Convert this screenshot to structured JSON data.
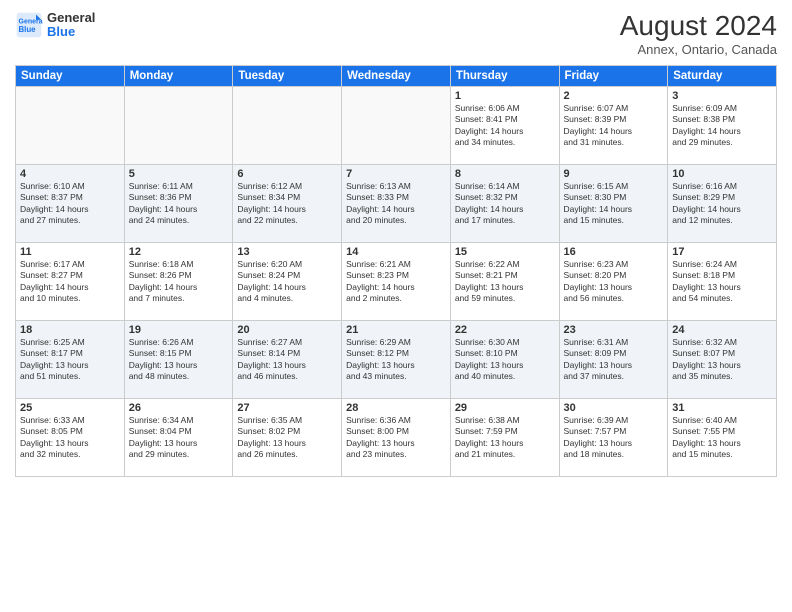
{
  "header": {
    "logo_line1": "General",
    "logo_line2": "Blue",
    "month_year": "August 2024",
    "location": "Annex, Ontario, Canada"
  },
  "weekdays": [
    "Sunday",
    "Monday",
    "Tuesday",
    "Wednesday",
    "Thursday",
    "Friday",
    "Saturday"
  ],
  "weeks": [
    [
      {
        "day": "",
        "info": ""
      },
      {
        "day": "",
        "info": ""
      },
      {
        "day": "",
        "info": ""
      },
      {
        "day": "",
        "info": ""
      },
      {
        "day": "1",
        "info": "Sunrise: 6:06 AM\nSunset: 8:41 PM\nDaylight: 14 hours\nand 34 minutes."
      },
      {
        "day": "2",
        "info": "Sunrise: 6:07 AM\nSunset: 8:39 PM\nDaylight: 14 hours\nand 31 minutes."
      },
      {
        "day": "3",
        "info": "Sunrise: 6:09 AM\nSunset: 8:38 PM\nDaylight: 14 hours\nand 29 minutes."
      }
    ],
    [
      {
        "day": "4",
        "info": "Sunrise: 6:10 AM\nSunset: 8:37 PM\nDaylight: 14 hours\nand 27 minutes."
      },
      {
        "day": "5",
        "info": "Sunrise: 6:11 AM\nSunset: 8:36 PM\nDaylight: 14 hours\nand 24 minutes."
      },
      {
        "day": "6",
        "info": "Sunrise: 6:12 AM\nSunset: 8:34 PM\nDaylight: 14 hours\nand 22 minutes."
      },
      {
        "day": "7",
        "info": "Sunrise: 6:13 AM\nSunset: 8:33 PM\nDaylight: 14 hours\nand 20 minutes."
      },
      {
        "day": "8",
        "info": "Sunrise: 6:14 AM\nSunset: 8:32 PM\nDaylight: 14 hours\nand 17 minutes."
      },
      {
        "day": "9",
        "info": "Sunrise: 6:15 AM\nSunset: 8:30 PM\nDaylight: 14 hours\nand 15 minutes."
      },
      {
        "day": "10",
        "info": "Sunrise: 6:16 AM\nSunset: 8:29 PM\nDaylight: 14 hours\nand 12 minutes."
      }
    ],
    [
      {
        "day": "11",
        "info": "Sunrise: 6:17 AM\nSunset: 8:27 PM\nDaylight: 14 hours\nand 10 minutes."
      },
      {
        "day": "12",
        "info": "Sunrise: 6:18 AM\nSunset: 8:26 PM\nDaylight: 14 hours\nand 7 minutes."
      },
      {
        "day": "13",
        "info": "Sunrise: 6:20 AM\nSunset: 8:24 PM\nDaylight: 14 hours\nand 4 minutes."
      },
      {
        "day": "14",
        "info": "Sunrise: 6:21 AM\nSunset: 8:23 PM\nDaylight: 14 hours\nand 2 minutes."
      },
      {
        "day": "15",
        "info": "Sunrise: 6:22 AM\nSunset: 8:21 PM\nDaylight: 13 hours\nand 59 minutes."
      },
      {
        "day": "16",
        "info": "Sunrise: 6:23 AM\nSunset: 8:20 PM\nDaylight: 13 hours\nand 56 minutes."
      },
      {
        "day": "17",
        "info": "Sunrise: 6:24 AM\nSunset: 8:18 PM\nDaylight: 13 hours\nand 54 minutes."
      }
    ],
    [
      {
        "day": "18",
        "info": "Sunrise: 6:25 AM\nSunset: 8:17 PM\nDaylight: 13 hours\nand 51 minutes."
      },
      {
        "day": "19",
        "info": "Sunrise: 6:26 AM\nSunset: 8:15 PM\nDaylight: 13 hours\nand 48 minutes."
      },
      {
        "day": "20",
        "info": "Sunrise: 6:27 AM\nSunset: 8:14 PM\nDaylight: 13 hours\nand 46 minutes."
      },
      {
        "day": "21",
        "info": "Sunrise: 6:29 AM\nSunset: 8:12 PM\nDaylight: 13 hours\nand 43 minutes."
      },
      {
        "day": "22",
        "info": "Sunrise: 6:30 AM\nSunset: 8:10 PM\nDaylight: 13 hours\nand 40 minutes."
      },
      {
        "day": "23",
        "info": "Sunrise: 6:31 AM\nSunset: 8:09 PM\nDaylight: 13 hours\nand 37 minutes."
      },
      {
        "day": "24",
        "info": "Sunrise: 6:32 AM\nSunset: 8:07 PM\nDaylight: 13 hours\nand 35 minutes."
      }
    ],
    [
      {
        "day": "25",
        "info": "Sunrise: 6:33 AM\nSunset: 8:05 PM\nDaylight: 13 hours\nand 32 minutes."
      },
      {
        "day": "26",
        "info": "Sunrise: 6:34 AM\nSunset: 8:04 PM\nDaylight: 13 hours\nand 29 minutes."
      },
      {
        "day": "27",
        "info": "Sunrise: 6:35 AM\nSunset: 8:02 PM\nDaylight: 13 hours\nand 26 minutes."
      },
      {
        "day": "28",
        "info": "Sunrise: 6:36 AM\nSunset: 8:00 PM\nDaylight: 13 hours\nand 23 minutes."
      },
      {
        "day": "29",
        "info": "Sunrise: 6:38 AM\nSunset: 7:59 PM\nDaylight: 13 hours\nand 21 minutes."
      },
      {
        "day": "30",
        "info": "Sunrise: 6:39 AM\nSunset: 7:57 PM\nDaylight: 13 hours\nand 18 minutes."
      },
      {
        "day": "31",
        "info": "Sunrise: 6:40 AM\nSunset: 7:55 PM\nDaylight: 13 hours\nand 15 minutes."
      }
    ]
  ]
}
